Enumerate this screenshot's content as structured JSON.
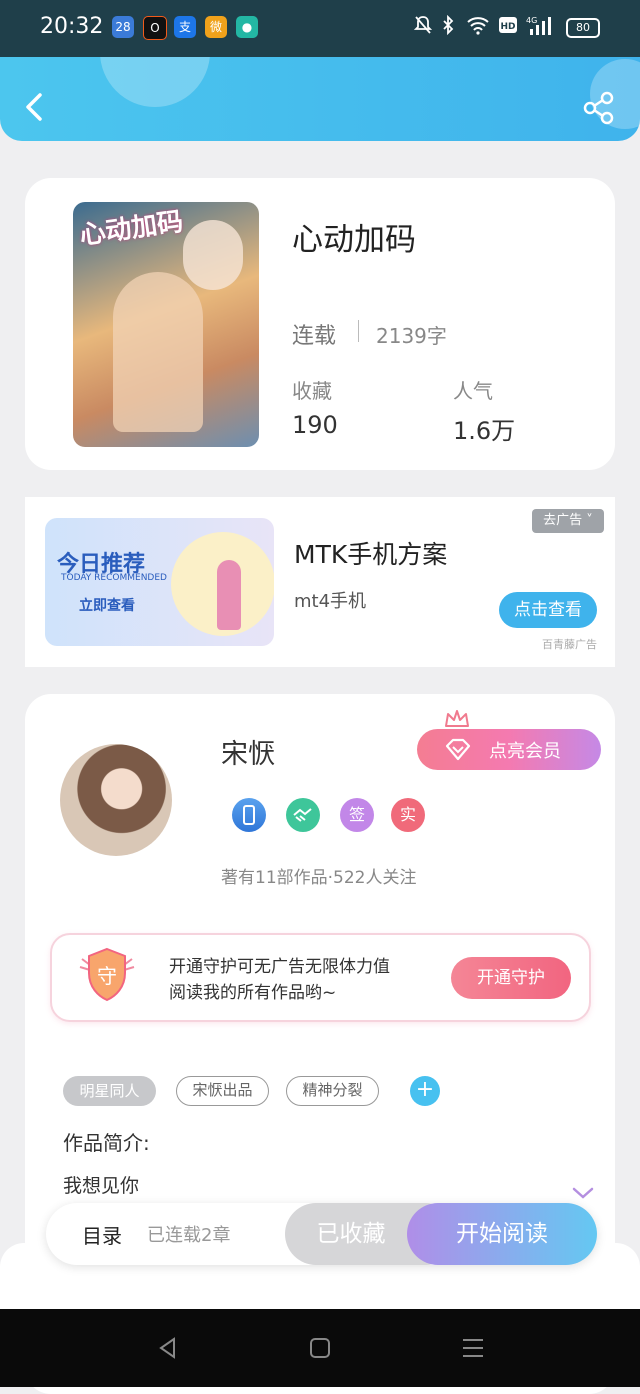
{
  "status_bar": {
    "time": "20:32",
    "app_icons": [
      {
        "name": "calendar-app-icon",
        "label": "28",
        "color": "#3b7bd8"
      },
      {
        "name": "orange-app-icon",
        "label": "O",
        "color": "#111111"
      },
      {
        "name": "alipay-app-icon",
        "label": "支",
        "color": "#1d76e8"
      },
      {
        "name": "weibo-app-icon",
        "label": "微",
        "color": "#f0a21b"
      },
      {
        "name": "messenger-app-icon",
        "label": "●",
        "color": "#23b7a4"
      }
    ],
    "battery": "80",
    "network": "4G"
  },
  "book": {
    "cover_text": "心动加码",
    "title": "心动加码",
    "status": "连载",
    "word_count": "2139字",
    "favorites_label": "收藏",
    "favorites_value": "190",
    "popularity_label": "人气",
    "popularity_value": "1.6万"
  },
  "ad": {
    "image_title": "今日推荐",
    "image_subtitle": "TODAY RECOMMENDED",
    "image_cta": "立即查看",
    "title": "MTK手机方案",
    "subtitle": "mt4手机",
    "close_label": "去广告 ˅",
    "button_label": "点击查看",
    "source": "百青藤广告"
  },
  "author": {
    "name": "宋恹",
    "vip_button": "点亮会员",
    "badges": [
      {
        "name": "phone-badge-icon",
        "label": "",
        "color": "#4b8ee8"
      },
      {
        "name": "handshake-badge-icon",
        "label": "",
        "color": "#3ec69a"
      },
      {
        "name": "sign-badge-icon",
        "label": "签",
        "color": "#c287e8"
      },
      {
        "name": "verified-badge-icon",
        "label": "实",
        "color": "#f06a7a"
      }
    ],
    "stats": "著有11部作品·522人关注"
  },
  "guard": {
    "shield_char": "守",
    "line1": "开通守护可无广告无限体力值",
    "line2": "阅读我的所有作品哟~",
    "button": "开通守护"
  },
  "tags": [
    "明星同人",
    "宋恹出品",
    "精神分裂"
  ],
  "intro": {
    "label": "作品简介:",
    "text": "我想见你"
  },
  "bottom_bar": {
    "toc": "目录",
    "toc_status": "已连载2章",
    "collected": "已收藏",
    "start_reading": "开始阅读"
  }
}
